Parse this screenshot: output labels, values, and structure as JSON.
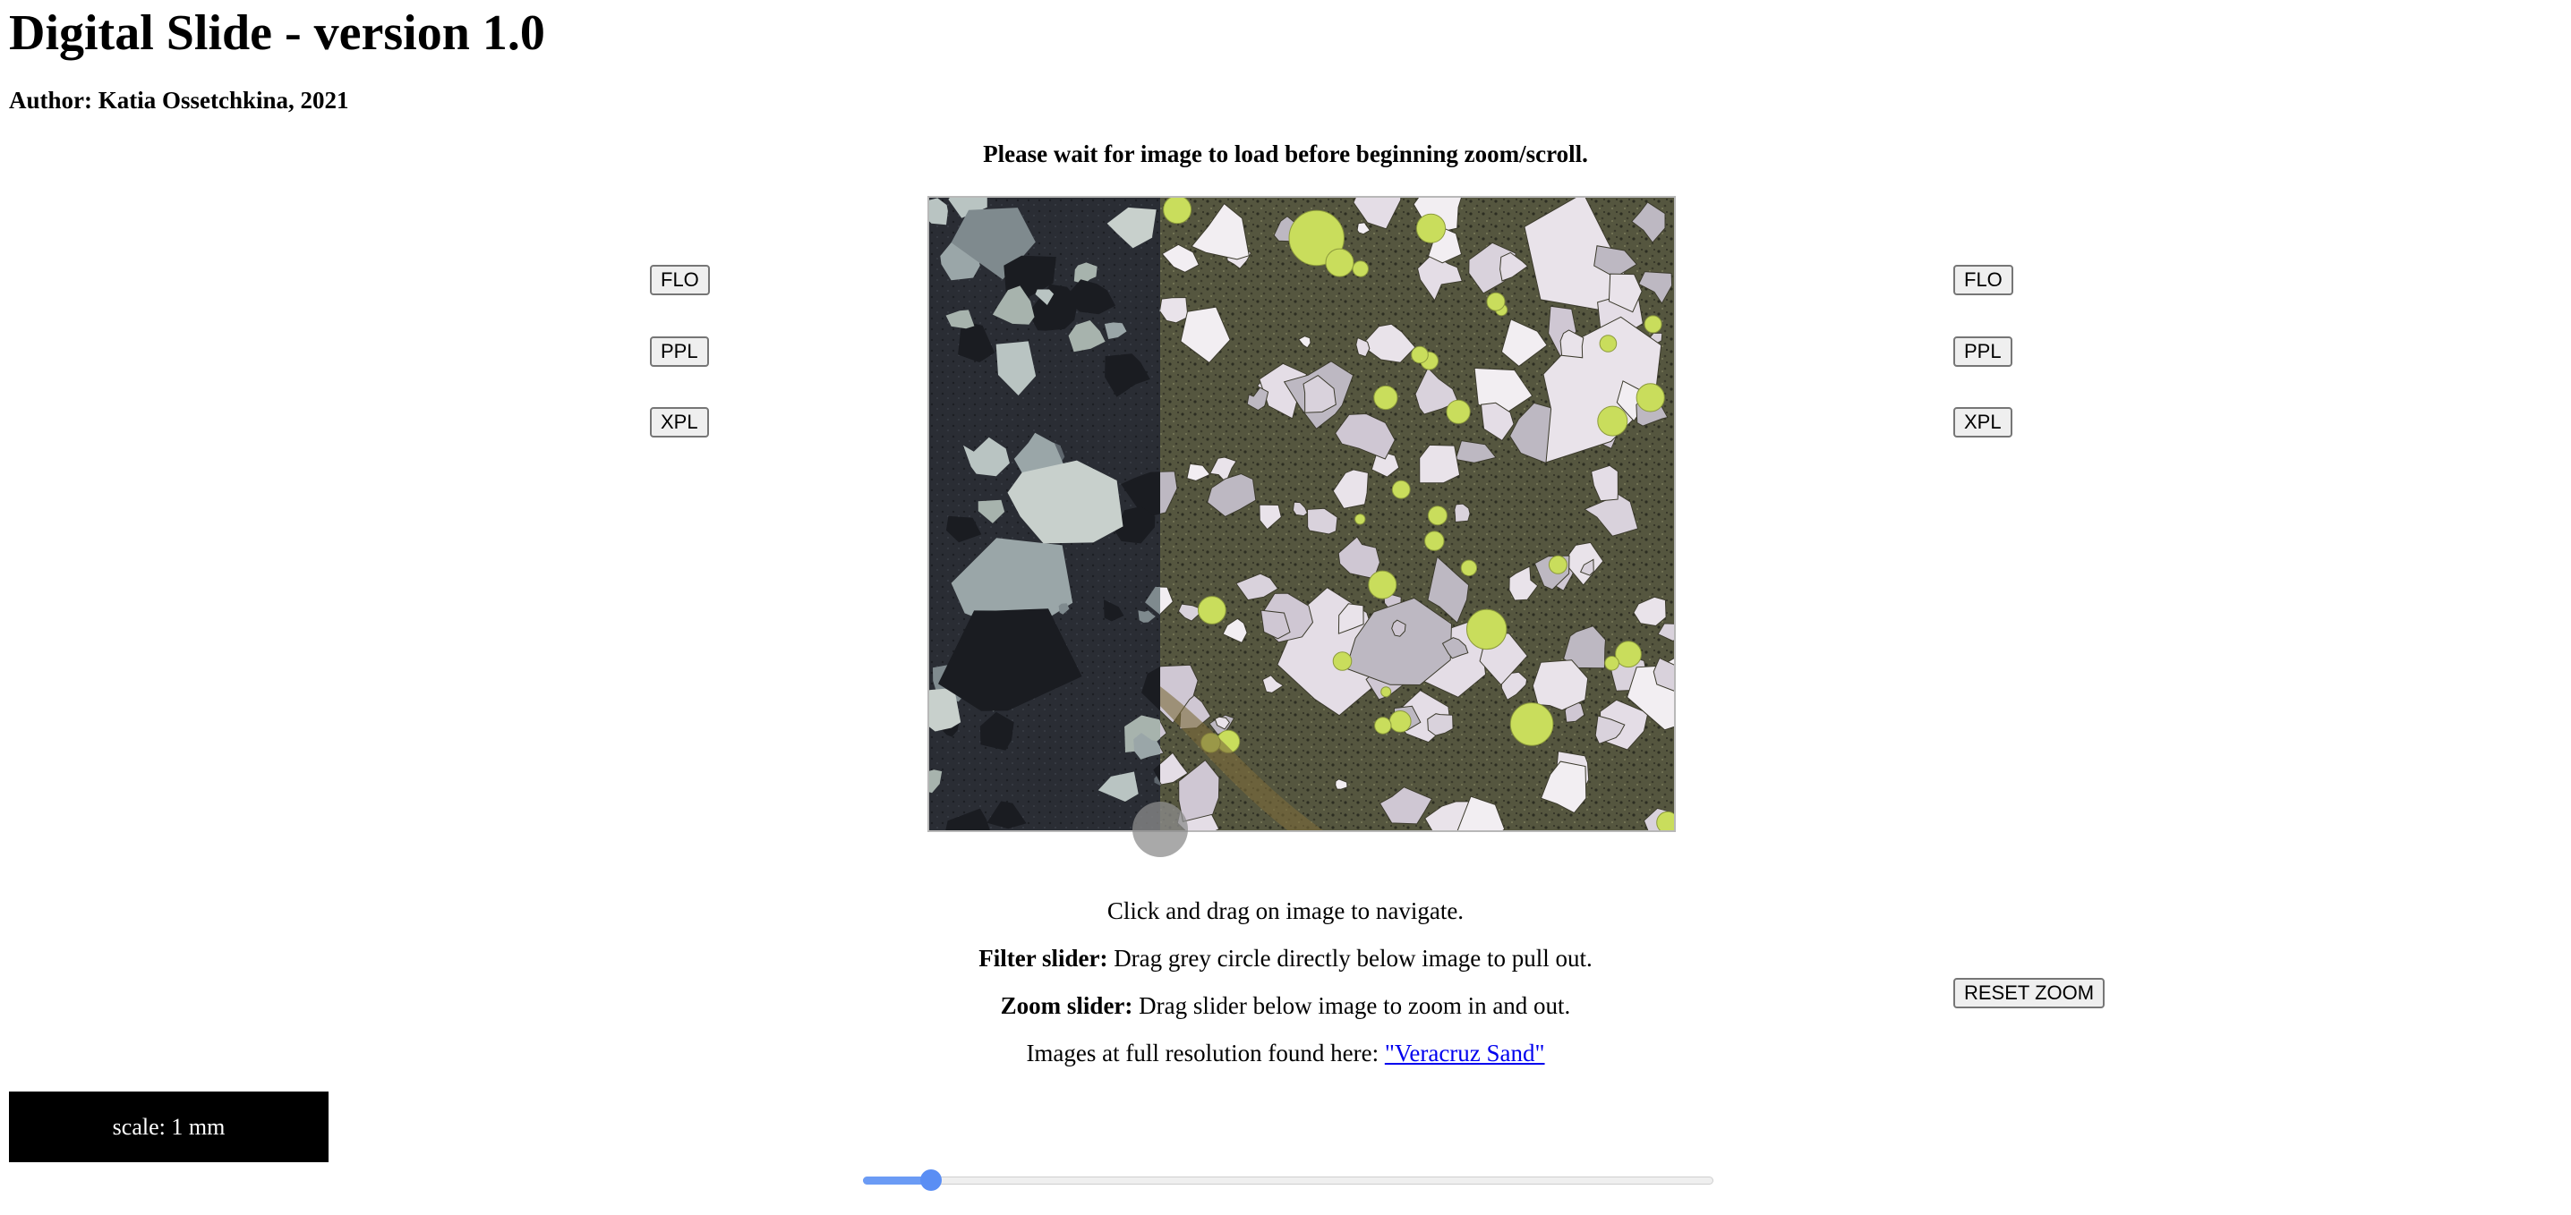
{
  "header": {
    "title": "Digital Slide - version 1.0",
    "author": "Author: Katia Ossetchkina, 2021",
    "notice": "Please wait for image to load before beginning zoom/scroll."
  },
  "left_panel": {
    "flo": "FLO",
    "ppl": "PPL",
    "xpl": "XPL"
  },
  "right_panel": {
    "flo": "FLO",
    "ppl": "PPL",
    "xpl": "XPL",
    "reset_zoom": "RESET ZOOM"
  },
  "filter_slider": {
    "split_fraction": 0.31
  },
  "instructions": {
    "navigate": "Click and drag on image to navigate.",
    "filter_label": "Filter slider:",
    "filter_text": " Drag grey circle directly below image to pull out.",
    "zoom_label": "Zoom slider:",
    "zoom_text": " Drag slider below image to zoom in and out.",
    "images_text": "Images at full resolution found here: ",
    "images_link": "\"Veracruz Sand\""
  },
  "scale": {
    "label": "scale: 1 mm"
  },
  "zoom_slider": {
    "value_fraction": 0.08
  },
  "colors": {
    "slider_accent": "#6b9bf5",
    "link": "#0000ee",
    "xpl_background": "#2b2e35",
    "ppl_matrix": "#5d5c45",
    "fluorescent_grain": "#c9dd5c"
  }
}
